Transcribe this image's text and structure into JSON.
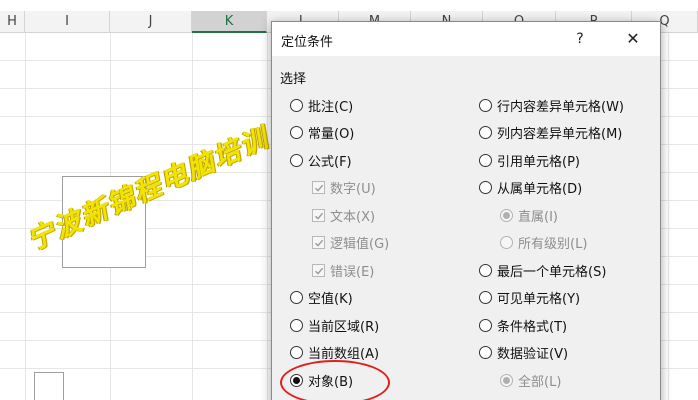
{
  "sheet": {
    "columns": [
      {
        "label": "H",
        "selected": false
      },
      {
        "label": "I",
        "selected": false
      },
      {
        "label": "J",
        "selected": false
      },
      {
        "label": "K",
        "selected": true
      },
      {
        "label": "L",
        "selected": false
      },
      {
        "label": "M",
        "selected": false
      },
      {
        "label": "N",
        "selected": false
      },
      {
        "label": "O",
        "selected": false
      },
      {
        "label": "P",
        "selected": false
      },
      {
        "label": "Q",
        "selected": false
      }
    ],
    "watermark": "宁波新锦程电脑培训"
  },
  "dialog": {
    "title": "定位条件",
    "help_label": "?",
    "close_label": "✕",
    "section_label": "选择",
    "left_options": [
      {
        "label": "批注(C)",
        "kind": "radio",
        "checked": false,
        "disabled": false
      },
      {
        "label": "常量(O)",
        "kind": "radio",
        "checked": false,
        "disabled": false
      },
      {
        "label": "公式(F)",
        "kind": "radio",
        "checked": false,
        "disabled": false
      },
      {
        "label": "数字(U)",
        "kind": "checkbox",
        "checked": true,
        "disabled": true
      },
      {
        "label": "文本(X)",
        "kind": "checkbox",
        "checked": true,
        "disabled": true
      },
      {
        "label": "逻辑值(G)",
        "kind": "checkbox",
        "checked": true,
        "disabled": true
      },
      {
        "label": "错误(E)",
        "kind": "checkbox",
        "checked": true,
        "disabled": true
      },
      {
        "label": "空值(K)",
        "kind": "radio",
        "checked": false,
        "disabled": false
      },
      {
        "label": "当前区域(R)",
        "kind": "radio",
        "checked": false,
        "disabled": false
      },
      {
        "label": "当前数组(A)",
        "kind": "radio",
        "checked": false,
        "disabled": false
      },
      {
        "label": "对象(B)",
        "kind": "radio",
        "checked": true,
        "disabled": false
      }
    ],
    "right_options": [
      {
        "label": "行内容差异单元格(W)",
        "kind": "radio",
        "checked": false,
        "disabled": false
      },
      {
        "label": "列内容差异单元格(M)",
        "kind": "radio",
        "checked": false,
        "disabled": false
      },
      {
        "label": "引用单元格(P)",
        "kind": "radio",
        "checked": false,
        "disabled": false
      },
      {
        "label": "从属单元格(D)",
        "kind": "radio",
        "checked": false,
        "disabled": false
      },
      {
        "label": "直属(I)",
        "kind": "radio",
        "checked": true,
        "disabled": true
      },
      {
        "label": "所有级别(L)",
        "kind": "radio",
        "checked": false,
        "disabled": true
      },
      {
        "label": "最后一个单元格(S)",
        "kind": "radio",
        "checked": false,
        "disabled": false
      },
      {
        "label": "可见单元格(Y)",
        "kind": "radio",
        "checked": false,
        "disabled": false
      },
      {
        "label": "条件格式(T)",
        "kind": "radio",
        "checked": false,
        "disabled": false
      },
      {
        "label": "数据验证(V)",
        "kind": "radio",
        "checked": false,
        "disabled": false
      },
      {
        "label": "全部(L)",
        "kind": "radio",
        "checked": true,
        "disabled": true
      }
    ]
  },
  "icons": {
    "check": "checkmark-icon",
    "help": "help-icon",
    "close": "close-icon"
  },
  "colors": {
    "selected_column": "#217346",
    "watermark": "#f2e400",
    "highlight_ring": "#e02020"
  }
}
